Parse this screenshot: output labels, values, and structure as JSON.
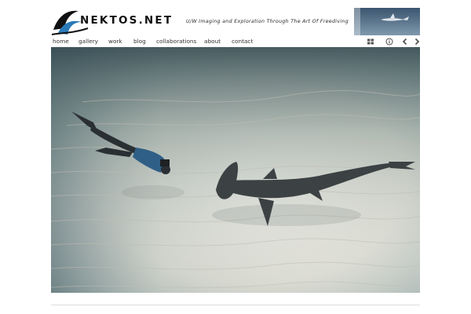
{
  "site": {
    "name": "NEKTOS.NET",
    "tagline": "U/W Imaging and Exploration Through The Art Of Freediving"
  },
  "nav": {
    "items": [
      "home",
      "gallery",
      "work",
      "blog",
      "collaborations",
      "about",
      "contact"
    ]
  },
  "toolbar": {
    "icons": [
      "grid-icon",
      "info-icon",
      "previous-icon",
      "next-icon"
    ]
  },
  "photo": {
    "subject": "freediver and hammerhead shark over sandy seabed"
  },
  "colors": {
    "text": "#333333",
    "water_top": "#3d5560",
    "sand": "#e8e6dc",
    "shark": "#3a3e40"
  }
}
